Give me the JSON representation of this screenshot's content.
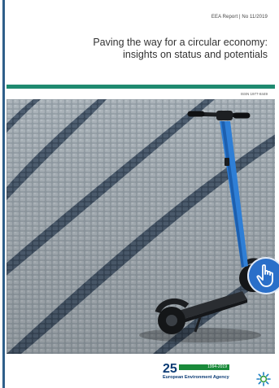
{
  "cover": {
    "report_ref": "EEA Report | No 11/2019",
    "title_line1": "Paving the way for a circular economy:",
    "title_line2": "insights on status and potentials",
    "isbn": "ISSN 1977-8449"
  },
  "footer": {
    "logo_number": "25",
    "logo_years": "1994-2019",
    "logo_name": "European Environment Agency"
  },
  "icons": {
    "cover_photo": "scooter-on-cobblestones-photo",
    "pointer": "hand-pointer-icon",
    "agency_logo": "eea-star-icon"
  },
  "colors": {
    "accent_green": "#1f8a70",
    "logo_blue": "#0b3b74",
    "logo_green": "#1a8a3a",
    "pointer_blue": "#2a6fc9"
  }
}
